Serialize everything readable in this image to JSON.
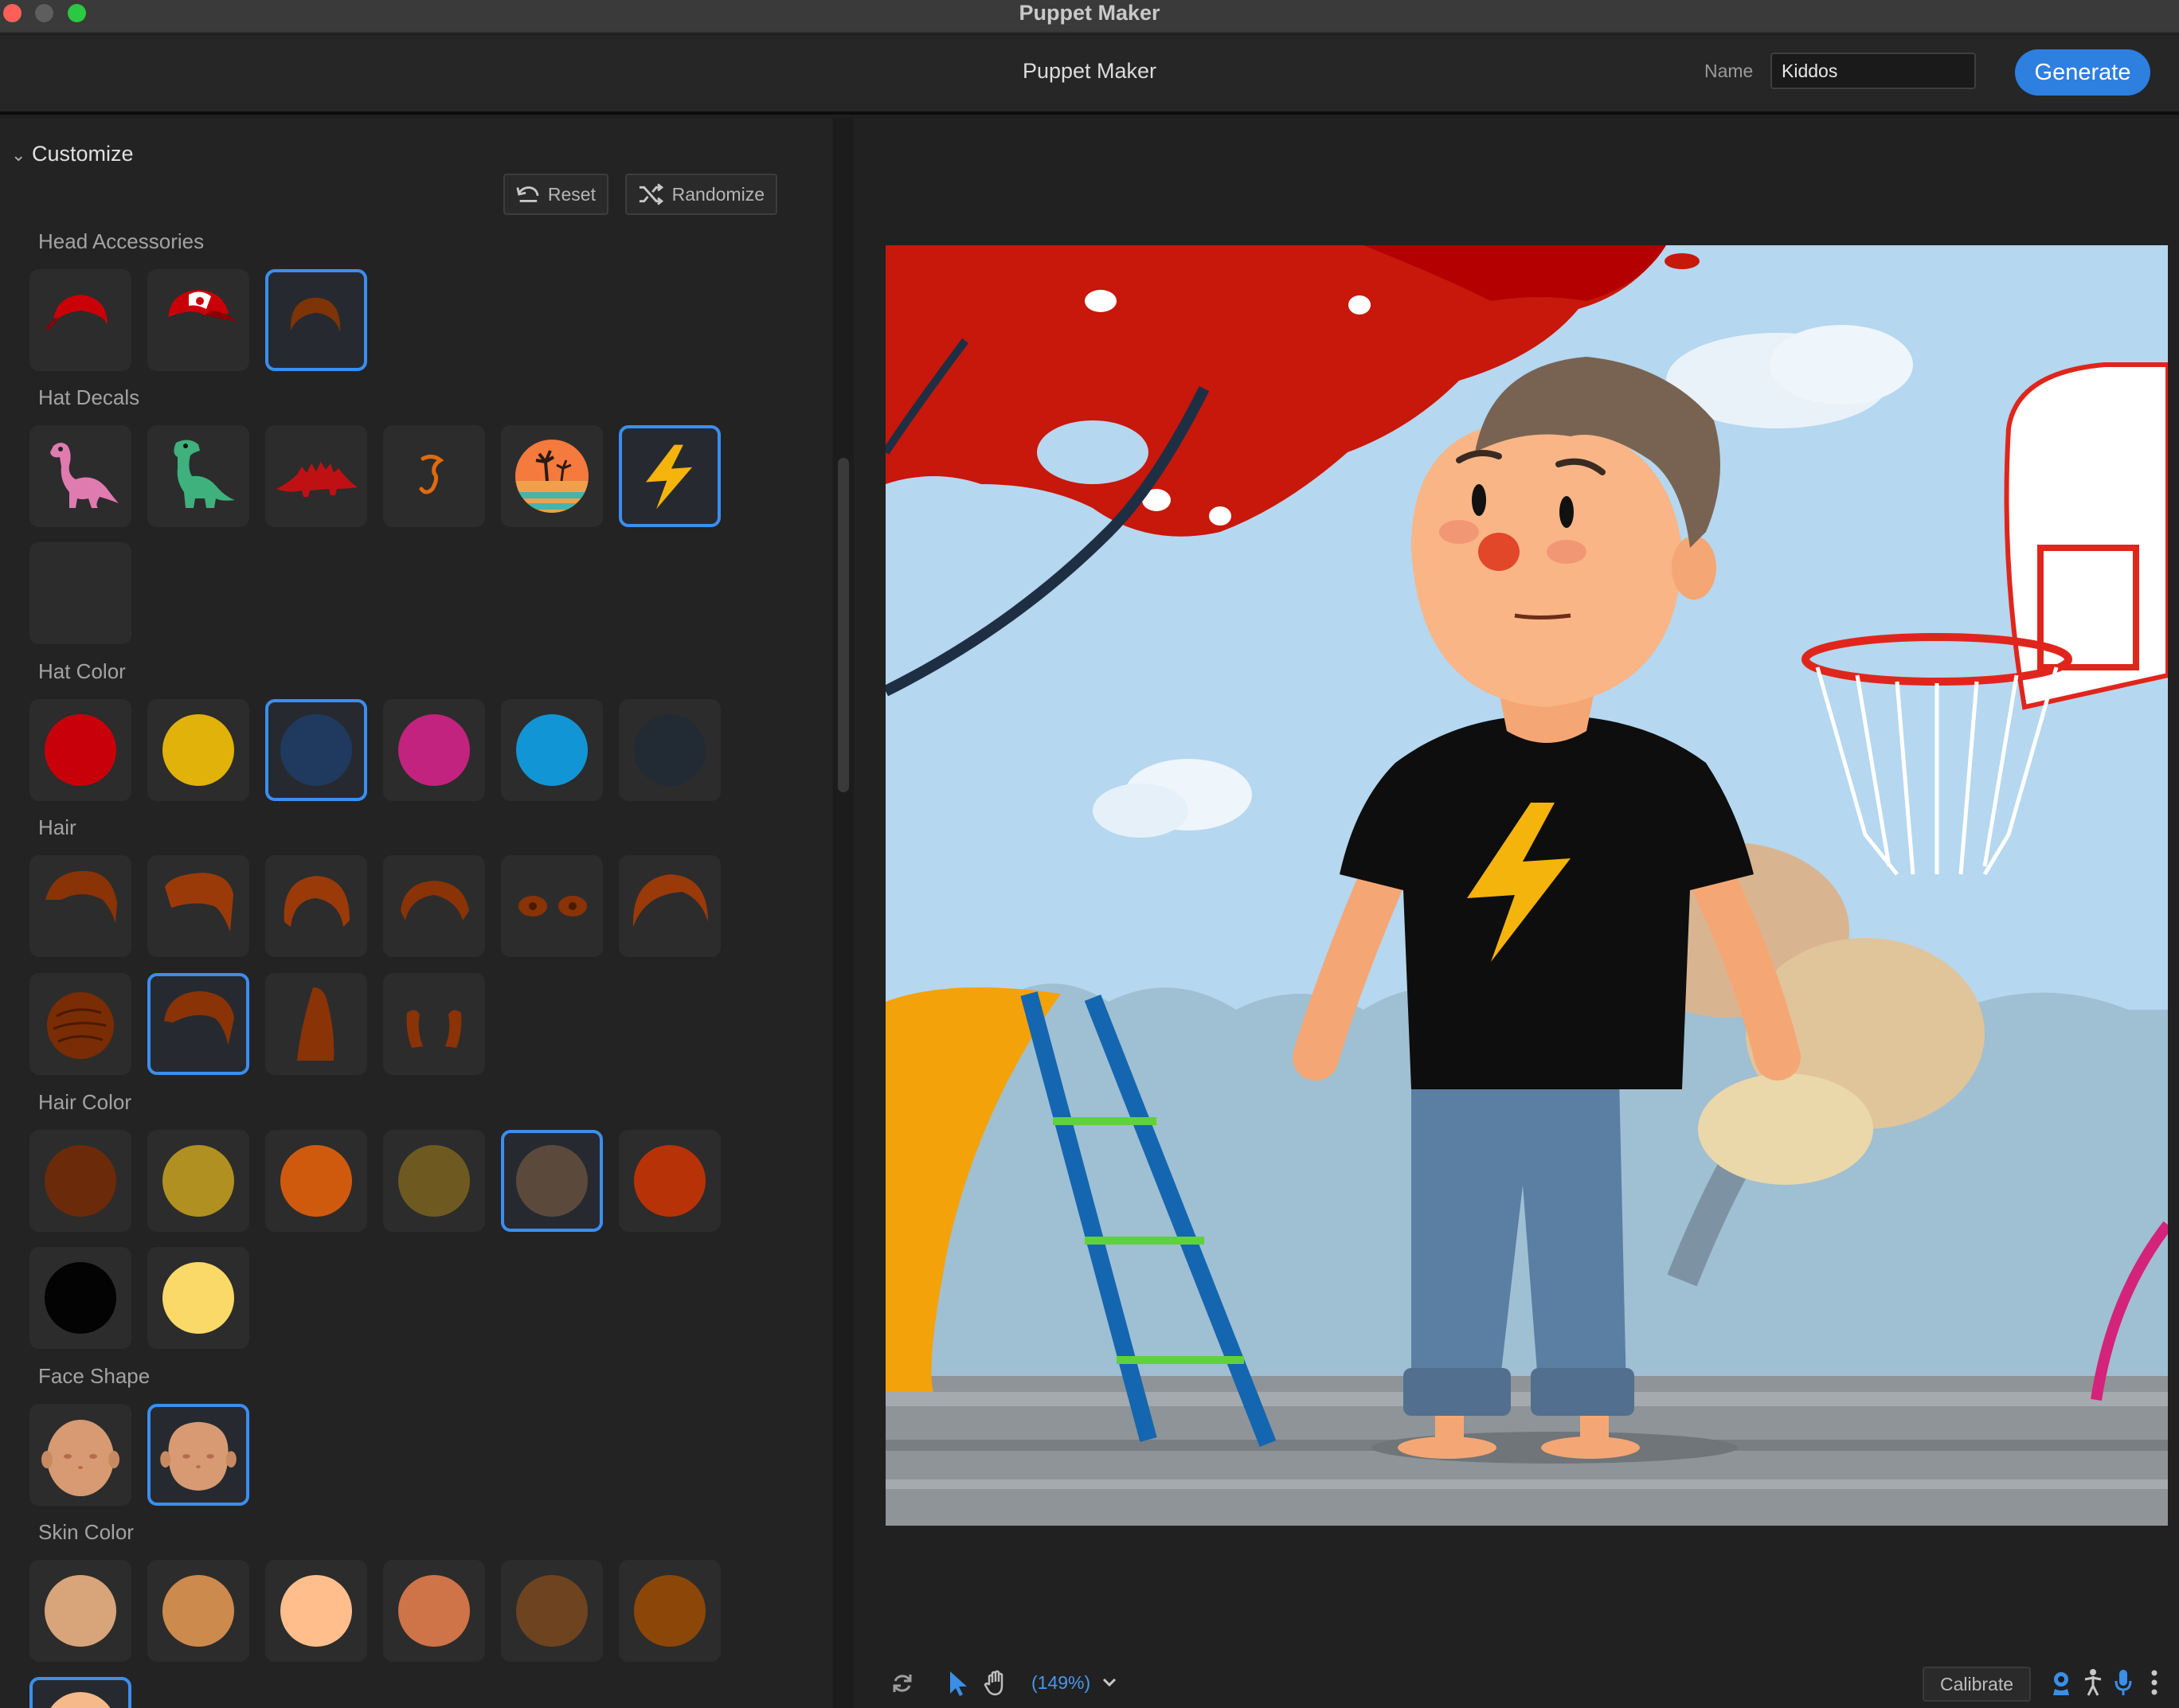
{
  "window": {
    "title": "Puppet Maker"
  },
  "header": {
    "title": "Puppet Maker",
    "name_label": "Name",
    "name_value": "Kiddos",
    "generate_label": "Generate"
  },
  "panel": {
    "section_title": "Customize",
    "reset_label": "Reset",
    "randomize_label": "Randomize",
    "head_accessories_label": "Head Accessories",
    "hat_decals_label": "Hat Decals",
    "hat_color_label": "Hat Color",
    "hair_label": "Hair",
    "hair_color_label": "Hair Color",
    "face_shape_label": "Face Shape",
    "skin_color_label": "Skin Color"
  },
  "hat_colors": [
    "#c8000a",
    "#e1b20a",
    "#1f3a5e",
    "#c2237e",
    "#1295d4",
    "#222a33"
  ],
  "hair_colors": [
    "#6b2a0a",
    "#b09020",
    "#cf5a0e",
    "#6e5a20",
    "#5b4a3c",
    "#b83208",
    "#030303",
    "#fbd968"
  ],
  "skin_colors": [
    "#d8a57a",
    "#cd8a4d",
    "#ffbe8c",
    "#ce7448",
    "#6e4320",
    "#8c4708",
    "#f5b98a"
  ],
  "selections": {
    "head_accessory": 3,
    "hat_decal": 6,
    "hat_color": 3,
    "hair": 8,
    "hair_color": 5,
    "face_shape": 2,
    "skin_color": 7
  },
  "footer": {
    "zoom": "(149%)",
    "calibrate_label": "Calibrate"
  }
}
